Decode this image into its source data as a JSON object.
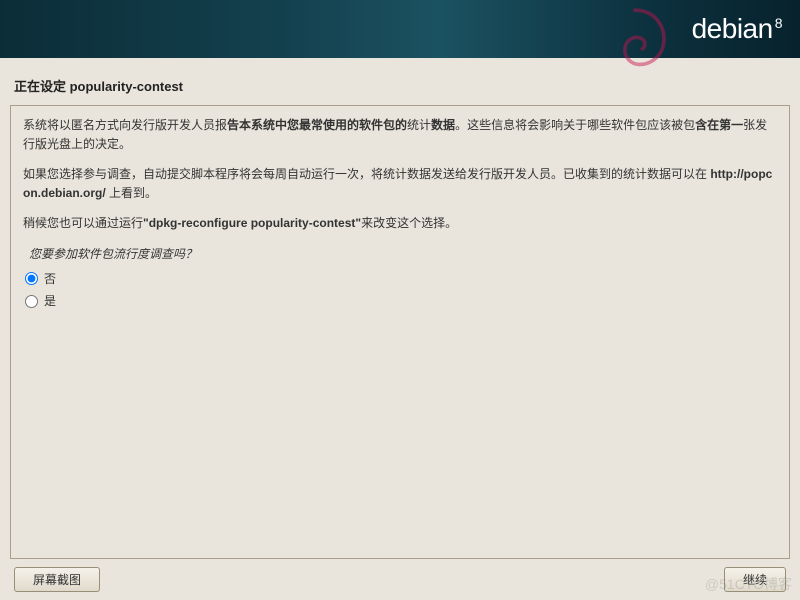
{
  "brand": {
    "name": "debian",
    "version": "8"
  },
  "title": "正在设定 popularity-contest",
  "paragraph1_pre": "系统将以匿名方式向发行版开发人员报",
  "paragraph1_bold1": "告本系统中您最常使用的软件包的",
  "paragraph1_mid": "统计",
  "paragraph1_bold2": "数据",
  "paragraph1_post": "。这些信息将会影响关于哪些软件包应该被包",
  "paragraph1_bold3": "含在第一",
  "paragraph1_end": "张发行版光盘上的决定。",
  "paragraph2_a": "如果您选择参与调查，自动提交脚本程序将会每周自动运行一次，将统计数据发送给发行版开发人员。已收集到的统计数据可以在 ",
  "paragraph2_url": "http://popcon.debian.org/",
  "paragraph2_b": " 上看到。",
  "paragraph3_a": "稍候您也可以通过运行",
  "paragraph3_cmd": "\"dpkg-reconfigure popularity-contest\"",
  "paragraph3_b": "来改变这个选择。",
  "question": "您要参加软件包流行度调查吗？",
  "options": {
    "no": "否",
    "yes": "是"
  },
  "buttons": {
    "screenshot": "屏幕截图",
    "continue": "继续"
  },
  "watermark": "@51CTO博客"
}
